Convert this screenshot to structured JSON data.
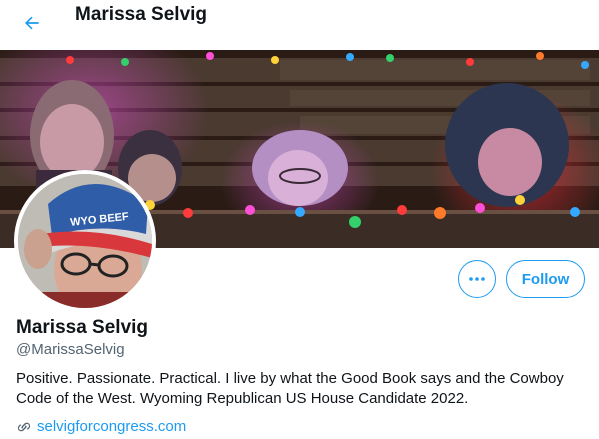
{
  "header": {
    "title": "Marissa Selvig",
    "back_icon": "arrow-left-icon"
  },
  "profile": {
    "display_name": "Marissa Selvig",
    "handle": "@MarissaSelvig",
    "bio": "Positive. Passionate. Practical. I live by what the Good Book says and the Cowboy Code of the West. Wyoming Republican US House Candidate 2022.",
    "website": "selvigforcongress.com",
    "avatar_hat_text": "WYO BEEF"
  },
  "actions": {
    "more_icon": "more-horizontal-icon",
    "follow_label": "Follow"
  },
  "colors": {
    "accent": "#1d9bf0",
    "text": "#0f1419",
    "muted": "#536471"
  }
}
